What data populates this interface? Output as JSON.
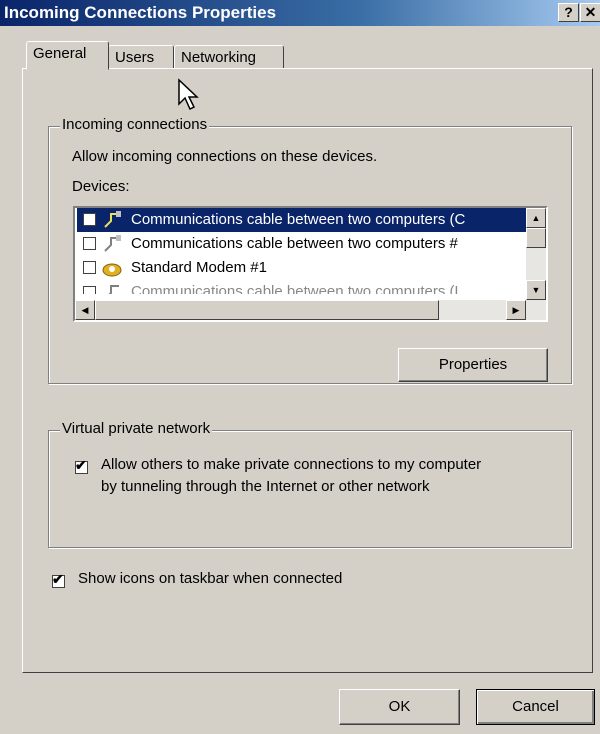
{
  "window": {
    "title": "Incoming Connections Properties",
    "help_button": "?",
    "close_button": "✕"
  },
  "tabs": [
    "General",
    "Users",
    "Networking"
  ],
  "incoming": {
    "legend": "Incoming connections",
    "description": "Allow incoming connections on these devices.",
    "devices_label": "Devices:",
    "devices": [
      {
        "label": "Communications cable between two computers (C",
        "checked": false,
        "selected": true,
        "icon": "cable-icon"
      },
      {
        "label": "Communications cable between two computers #",
        "checked": false,
        "selected": false,
        "icon": "cable-icon"
      },
      {
        "label": "Standard Modem #1",
        "checked": false,
        "selected": false,
        "icon": "modem-icon"
      },
      {
        "label": "Communications cable between two computers (L",
        "checked": false,
        "selected": false,
        "icon": "cable-icon"
      }
    ],
    "properties_button": "Properties"
  },
  "vpn": {
    "legend": "Virtual private network",
    "allow_label_line1": "Allow others to make private connections to my computer",
    "allow_label_line2": "by tunneling through the Internet or other network",
    "checked": true
  },
  "show_icons": {
    "label": "Show icons on taskbar when connected",
    "checked": true
  },
  "buttons": {
    "ok": "OK",
    "cancel": "Cancel"
  }
}
